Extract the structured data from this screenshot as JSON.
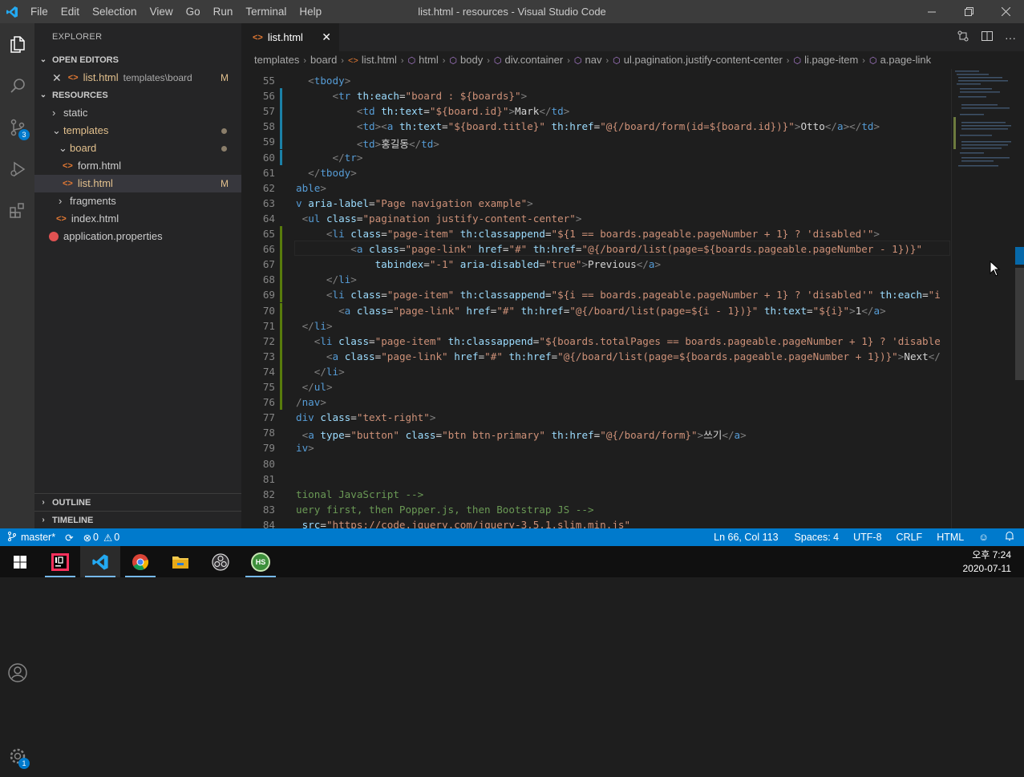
{
  "window": {
    "title": "list.html - resources - Visual Studio Code",
    "menu": [
      "File",
      "Edit",
      "Selection",
      "View",
      "Go",
      "Run",
      "Terminal",
      "Help"
    ]
  },
  "activity": {
    "icons": [
      "files-icon",
      "search-icon",
      "source-control-icon",
      "run-debug-icon",
      "extensions-icon"
    ],
    "scm_badge": "3",
    "settings_badge": "1"
  },
  "explorer": {
    "title": "EXPLORER",
    "open_editors": {
      "label": "OPEN EDITORS",
      "file": "list.html",
      "path": "templates\\board",
      "status": "M"
    },
    "project": {
      "label": "RESOURCES"
    },
    "tree": [
      {
        "label": "static",
        "type": "folder",
        "depth": 1
      },
      {
        "label": "templates",
        "type": "folder-open",
        "depth": 1
      },
      {
        "label": "board",
        "type": "folder-open",
        "depth": 2
      },
      {
        "label": "form.html",
        "type": "html",
        "depth": 3
      },
      {
        "label": "list.html",
        "type": "html",
        "depth": 3,
        "status": "M"
      },
      {
        "label": "fragments",
        "type": "folder",
        "depth": 2
      },
      {
        "label": "index.html",
        "type": "html",
        "depth": 2
      },
      {
        "label": "application.properties",
        "type": "props",
        "depth": 1
      }
    ],
    "outline": "OUTLINE",
    "timeline": "TIMELINE"
  },
  "tab": {
    "label": "list.html"
  },
  "breadcrumbs": [
    "templates",
    "board",
    "list.html",
    "html",
    "body",
    "div.container",
    "nav",
    "ul.pagination.justify-content-center",
    "li.page-item",
    "a.page-link"
  ],
  "code": [
    {
      "n": "55",
      "g": "",
      "h": "  <span class=\"p\">&lt;</span><span class=\"t\">tbody</span><span class=\"p\">&gt;</span>"
    },
    {
      "n": "56",
      "g": "b",
      "h": "      <span class=\"p\">&lt;</span><span class=\"t\">tr</span> <span class=\"a\">th:each</span>=<span class=\"s\">\"board : ${boards}\"</span><span class=\"p\">&gt;</span>"
    },
    {
      "n": "57",
      "g": "b",
      "h": "          <span class=\"p\">&lt;</span><span class=\"t\">td</span> <span class=\"a\">th:text</span>=<span class=\"s\">\"${board.id}\"</span><span class=\"p\">&gt;</span>Mark<span class=\"p\">&lt;/</span><span class=\"t\">td</span><span class=\"p\">&gt;</span>"
    },
    {
      "n": "58",
      "g": "b",
      "h": "          <span class=\"p\">&lt;</span><span class=\"t\">td</span><span class=\"p\">&gt;&lt;</span><span class=\"t\">a</span> <span class=\"a\">th:text</span>=<span class=\"s\">\"${board.title}\"</span> <span class=\"a\">th:href</span>=<span class=\"s\">\"@{/board/form(id=${board.id})}\"</span><span class=\"p\">&gt;</span>Otto<span class=\"p\">&lt;/</span><span class=\"t\">a</span><span class=\"p\">&gt;&lt;/</span><span class=\"t\">td</span><span class=\"p\">&gt;</span>"
    },
    {
      "n": "59",
      "g": "b",
      "h": "          <span class=\"p\">&lt;</span><span class=\"t\">td</span><span class=\"p\">&gt;</span>홍길동<span class=\"p\">&lt;/</span><span class=\"t\">td</span><span class=\"p\">&gt;</span>"
    },
    {
      "n": "60",
      "g": "b",
      "h": "      <span class=\"p\">&lt;/</span><span class=\"t\">tr</span><span class=\"p\">&gt;</span>"
    },
    {
      "n": "61",
      "g": "",
      "h": "  <span class=\"p\">&lt;/</span><span class=\"t\">tbody</span><span class=\"p\">&gt;</span>"
    },
    {
      "n": "62",
      "g": "",
      "h": "<span class=\"t\">able</span><span class=\"p\">&gt;</span>"
    },
    {
      "n": "63",
      "g": "",
      "h": "<span class=\"t\">v</span> <span class=\"a\">aria-label</span>=<span class=\"s\">\"Page navigation example\"</span><span class=\"p\">&gt;</span>"
    },
    {
      "n": "64",
      "g": "",
      "h": " <span class=\"p\">&lt;</span><span class=\"t\">ul</span> <span class=\"a\">class</span>=<span class=\"s\">\"pagination justify-content-center\"</span><span class=\"p\">&gt;</span>"
    },
    {
      "n": "65",
      "g": "y",
      "h": "     <span class=\"p\">&lt;</span><span class=\"t\">li</span> <span class=\"a\">class</span>=<span class=\"s\">\"page-item\"</span> <span class=\"a\">th:classappend</span>=<span class=\"s\">\"${1 == boards.pageable.pageNumber + 1} ? 'disabled'\"</span><span class=\"p\">&gt;</span>"
    },
    {
      "n": "66",
      "g": "y",
      "h": "         <span class=\"p\">&lt;</span><span class=\"t\">a</span> <span class=\"a\">class</span>=<span class=\"s\">\"page-link\"</span> <span class=\"a\">href</span>=<span class=\"s\">\"#\"</span> <span class=\"a\">th:href</span>=<span class=\"s\">\"@{/board/list(page=${boards.pageable.pageNumber - 1})}\"</span>"
    },
    {
      "n": "67",
      "g": "y",
      "h": "             <span class=\"a\">tabindex</span>=<span class=\"s\">\"-1\"</span> <span class=\"a\">aria-disabled</span>=<span class=\"s\">\"true\"</span><span class=\"p\">&gt;</span>Previous<span class=\"p\">&lt;/</span><span class=\"t\">a</span><span class=\"p\">&gt;</span>"
    },
    {
      "n": "68",
      "g": "y",
      "h": "     <span class=\"p\">&lt;/</span><span class=\"t\">li</span><span class=\"p\">&gt;</span>"
    },
    {
      "n": "69",
      "g": "y",
      "h": "     <span class=\"p\">&lt;</span><span class=\"t\">li</span> <span class=\"a\">class</span>=<span class=\"s\">\"page-item\"</span> <span class=\"a\">th:classappend</span>=<span class=\"s\">\"${i == boards.pageable.pageNumber + 1} ? 'disabled'\"</span> <span class=\"a\">th:each</span>=<span class=\"s\">\"i</span>"
    },
    {
      "n": "70",
      "g": "y",
      "h": "       <span class=\"p\">&lt;</span><span class=\"t\">a</span> <span class=\"a\">class</span>=<span class=\"s\">\"page-link\"</span> <span class=\"a\">href</span>=<span class=\"s\">\"#\"</span> <span class=\"a\">th:href</span>=<span class=\"s\">\"@{/board/list(page=${i - 1})}\"</span> <span class=\"a\">th:text</span>=<span class=\"s\">\"${i}\"</span><span class=\"p\">&gt;</span>1<span class=\"p\">&lt;/</span><span class=\"t\">a</span><span class=\"p\">&gt;</span>"
    },
    {
      "n": "71",
      "g": "y",
      "h": " <span class=\"p\">&lt;/</span><span class=\"t\">li</span><span class=\"p\">&gt;</span>"
    },
    {
      "n": "72",
      "g": "y",
      "h": "   <span class=\"p\">&lt;</span><span class=\"t\">li</span> <span class=\"a\">class</span>=<span class=\"s\">\"page-item\"</span> <span class=\"a\">th:classappend</span>=<span class=\"s\">\"${boards.totalPages == boards.pageable.pageNumber + 1} ? 'disable</span>"
    },
    {
      "n": "73",
      "g": "y",
      "h": "     <span class=\"p\">&lt;</span><span class=\"t\">a</span> <span class=\"a\">class</span>=<span class=\"s\">\"page-link\"</span> <span class=\"a\">href</span>=<span class=\"s\">\"#\"</span> <span class=\"a\">th:href</span>=<span class=\"s\">\"@{/board/list(page=${boards.pageable.pageNumber + 1})}\"</span><span class=\"p\">&gt;</span>Next<span class=\"p\">&lt;/</span>"
    },
    {
      "n": "74",
      "g": "y",
      "h": "   <span class=\"p\">&lt;/</span><span class=\"t\">li</span><span class=\"p\">&gt;</span>"
    },
    {
      "n": "75",
      "g": "y",
      "h": " <span class=\"p\">&lt;/</span><span class=\"t\">ul</span><span class=\"p\">&gt;</span>"
    },
    {
      "n": "76",
      "g": "y",
      "h": "<span class=\"p\">/</span><span class=\"t\">nav</span><span class=\"p\">&gt;</span>"
    },
    {
      "n": "77",
      "g": "",
      "h": "<span class=\"t\">div</span> <span class=\"a\">class</span>=<span class=\"s\">\"text-right\"</span><span class=\"p\">&gt;</span>"
    },
    {
      "n": "78",
      "g": "",
      "h": " <span class=\"p\">&lt;</span><span class=\"t\">a</span> <span class=\"a\">type</span>=<span class=\"s\">\"button\"</span> <span class=\"a\">class</span>=<span class=\"s\">\"btn btn-primary\"</span> <span class=\"a\">th:href</span>=<span class=\"s\">\"@{/board/form}\"</span><span class=\"p\">&gt;</span>쓰기<span class=\"p\">&lt;/</span><span class=\"t\">a</span><span class=\"p\">&gt;</span>"
    },
    {
      "n": "79",
      "g": "",
      "h": "<span class=\"t\">iv</span><span class=\"p\">&gt;</span>"
    },
    {
      "n": "80",
      "g": "",
      "h": ""
    },
    {
      "n": "81",
      "g": "",
      "h": ""
    },
    {
      "n": "82",
      "g": "",
      "h": "<span class=\"c\">tional JavaScript --&gt;</span>"
    },
    {
      "n": "83",
      "g": "",
      "h": "<span class=\"c\">uery first, then Popper.js, then Bootstrap JS --&gt;</span>"
    },
    {
      "n": "84",
      "g": "",
      "h": " <span class=\"a\">src</span>=<span class=\"s\">\"https://code.jquery.com/jquery-3.5.1.slim.min.js\"</span>"
    }
  ],
  "status": {
    "branch": "master*",
    "errors": "0",
    "warnings": "0",
    "position": "Ln 66, Col 113",
    "spaces": "Spaces: 4",
    "encoding": "UTF-8",
    "eol": "CRLF",
    "language": "HTML"
  },
  "taskbar": {
    "time": "오후 7:24",
    "date": "2020-07-11",
    "apps": [
      "intellij-icon",
      "vscode-icon",
      "chrome-icon",
      "file-explorer-icon",
      "obs-icon",
      "hs-icon"
    ],
    "hs_label": "HS"
  }
}
